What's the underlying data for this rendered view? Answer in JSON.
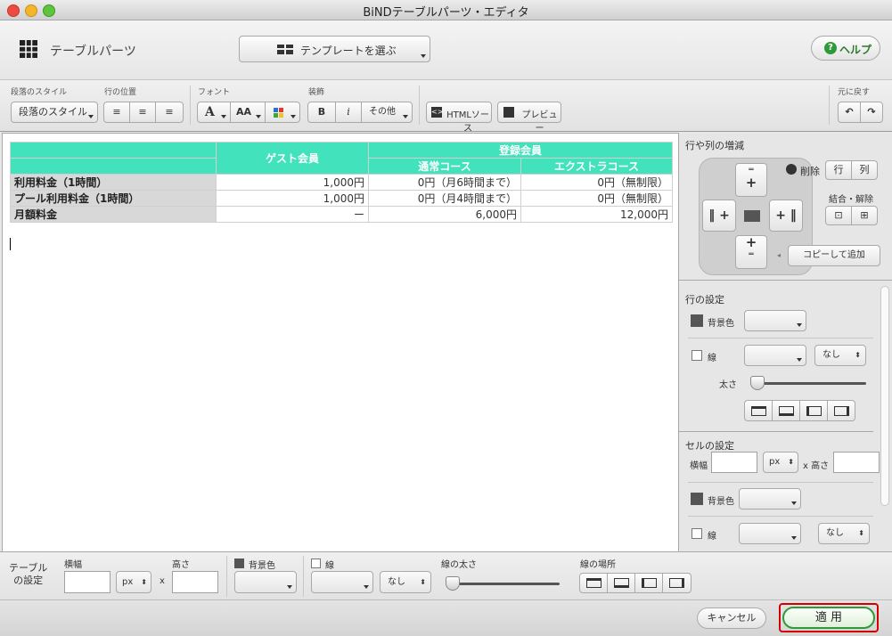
{
  "window": {
    "title": "BiNDテーブルパーツ・エディタ"
  },
  "header": {
    "app_label": "テーブルパーツ",
    "template_button": "テンプレートを選ぶ",
    "help_button": "ヘルプ"
  },
  "toolbar": {
    "para_style_label": "段落のスタイル",
    "para_style_value": "段落のスタイル",
    "row_pos_label": "行の位置",
    "font_label": "フォント",
    "font_a": "A",
    "font_aa": "AA",
    "decor_label": "装飾",
    "bold": "B",
    "italic": "i",
    "other": "その他",
    "html_source": "HTMLソース",
    "preview": "プレビュー",
    "undo_label": "元に戻す"
  },
  "table": {
    "header_guest": "ゲスト会員",
    "header_registered": "登録会員",
    "header_normal": "通常コース",
    "header_extra": "エクストラコース",
    "rows": [
      {
        "label": "利用料金（1時間）",
        "guest": "1,000円",
        "normal": "0円（月6時間まで）",
        "extra": "0円（無制限）"
      },
      {
        "label": "プール利用料金（1時間）",
        "guest": "1,000円",
        "normal": "0円（月4時間まで）",
        "extra": "0円（無制限）"
      },
      {
        "label": "月額料金",
        "guest": "ー",
        "normal": "6,000円",
        "extra": "12,000円"
      }
    ]
  },
  "right_panel": {
    "rowcol_title": "行や列の増減",
    "delete_label": "削除",
    "delete_row": "行",
    "delete_col": "列",
    "plus": "+",
    "merge_label": "結合・解除",
    "copy_add": "コピーして追加",
    "row_settings_title": "行の設定",
    "bg_color": "背景色",
    "line": "線",
    "line_style": "なし",
    "thickness": "太さ",
    "cell_settings_title": "セルの設定",
    "width_label": "横幅",
    "unit": "px",
    "height_label": "x 高さ",
    "cell_bg": "背景色",
    "cell_line": "線",
    "cell_line_style": "なし"
  },
  "table_settings": {
    "title_line1": "テーブル",
    "title_line2": "の設定",
    "width_label": "横幅",
    "height_label": "高さ",
    "unit": "px",
    "times": "x",
    "bg_color": "背景色",
    "line": "線",
    "line_style": "なし",
    "line_thickness": "線の太さ",
    "line_location": "線の場所"
  },
  "footer": {
    "cancel": "キャンセル",
    "apply": "適 用"
  },
  "colors": {
    "teal": "#41e2bc",
    "help_green": "#2e9a3a",
    "apply_border": "#d40000"
  }
}
